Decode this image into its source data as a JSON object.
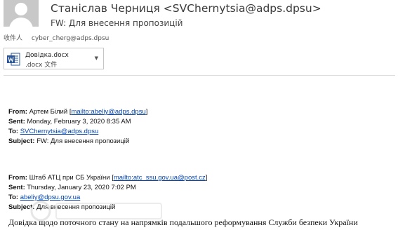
{
  "message": {
    "sender": "Станіслав Черниця <SVChernytsia@adps.dpsu>",
    "subject": "FW: Для внесення пропозицій",
    "recipient_label": "收件人",
    "recipient": "cyber_cherg@adps.dpsu"
  },
  "attachment": {
    "name": "Довідка.docx",
    "type": ".docx 文件",
    "icon": "word-document-icon"
  },
  "forward1": {
    "from_label": "From:",
    "from_name": "Артем Білий [",
    "from_link": "mailto:abeliy@adps.dpsu",
    "from_end": "]",
    "sent_label": "Sent:",
    "sent": "Monday, February 3, 2020 8:35 AM",
    "to_label": "To:",
    "to": "SVChernytsia@adps.dpsu",
    "subject_label": "Subject:",
    "subject": "FW: Для внесення пропозицій"
  },
  "forward2": {
    "from_label": "From:",
    "from_name": "Штаб АТЦ при СБ України [",
    "from_link": "mailto:atc_ssu.gov.ua@post.cz",
    "from_end": "]",
    "sent_label": "Sent:",
    "sent": "Thursday, January 23, 2020 7:02 PM",
    "to_label": "To:",
    "to": "abeliy@dpsu.gov.ua",
    "subject_label": "Subject:",
    "subject": "Для внесення пропозицій"
  },
  "body_text": "Довідка щодо поточного стану на напрямків подальшого реформування Служби безпеки України",
  "colors": {
    "link": "#0645ad",
    "word_blue": "#2b579a",
    "avatar_bg": "#c8c8c8"
  }
}
